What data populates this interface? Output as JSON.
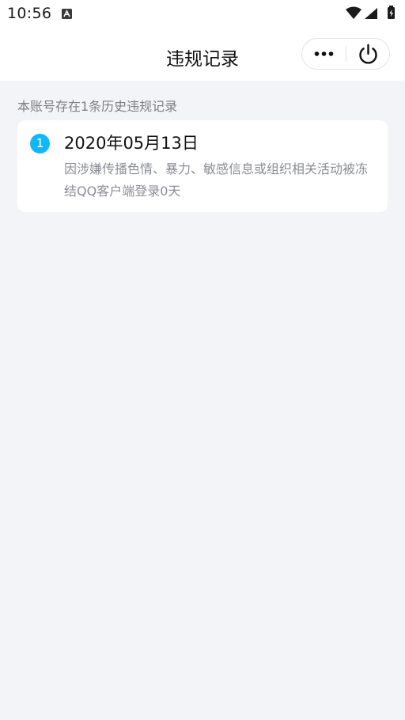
{
  "status_bar": {
    "time": "10:56",
    "app_icon": "a-letter-icon",
    "icons": [
      "wifi-icon",
      "signal-icon",
      "battery-charging-icon"
    ]
  },
  "header": {
    "title": "违规记录",
    "more_icon": "more-dots-icon",
    "power_icon": "power-icon"
  },
  "notice": "本账号存在1条历史违规记录",
  "records": [
    {
      "index": "1",
      "date": "2020年05月13日",
      "description": "因涉嫌传播色情、暴力、敏感信息或组织相关活动被冻结QQ客户端登录0天"
    }
  ],
  "colors": {
    "background": "#f3f4f8",
    "card": "#ffffff",
    "badge": "#12b7f5",
    "secondary_text": "#8b8e94"
  }
}
